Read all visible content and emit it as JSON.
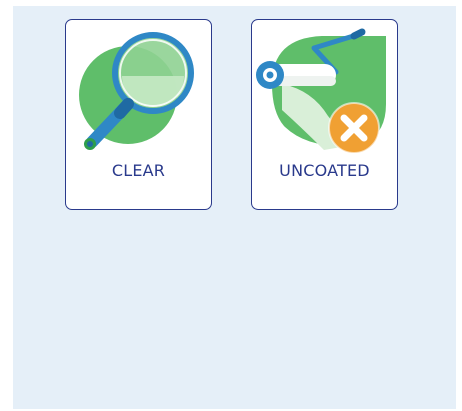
{
  "options": [
    {
      "label": "CLEAR",
      "icon": "magnifier-icon"
    },
    {
      "label": "UNCOATED",
      "icon": "paint-roller-cancel-icon"
    }
  ],
  "colors": {
    "panel_background": "#e5eff8",
    "card_border": "#2a3a8c",
    "label_text": "#2a3a8c",
    "green": "#5fbe6a",
    "blue": "#2f88c6",
    "orange": "#f0a033"
  }
}
